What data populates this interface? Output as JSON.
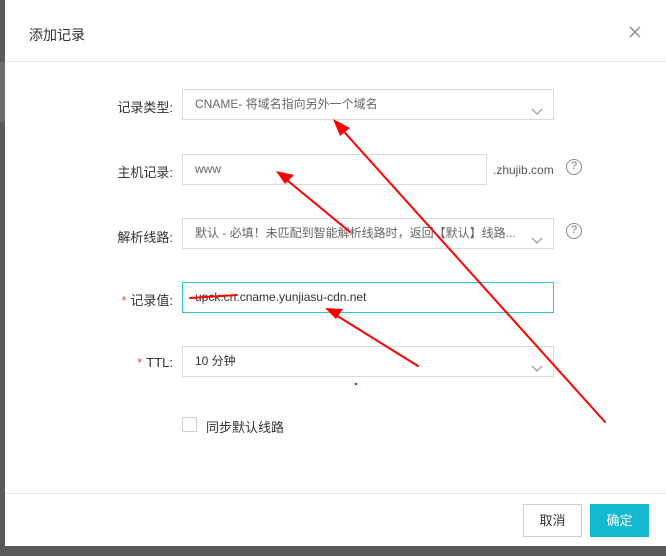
{
  "dialog": {
    "title": "添加记录",
    "close_icon": "close-icon"
  },
  "form": {
    "record_type": {
      "label": "记录类型:",
      "value": "CNAME- 将域名指向另外一个域名"
    },
    "host": {
      "label": "主机记录:",
      "value": "www",
      "suffix": ".zhujib.com"
    },
    "line": {
      "label": "解析线路:",
      "value": "默认 - 必填！未匹配到智能解析线路时，返回【默认】线路..."
    },
    "record_value": {
      "required_mark": "*",
      "label": "记录值:",
      "value": "upck.cn.cname.yunjiasu-cdn.net"
    },
    "ttl": {
      "required_mark": "*",
      "label": "TTL:",
      "value": "10 分钟"
    },
    "sync_default": {
      "label": "同步默认线路",
      "checked": false
    }
  },
  "help_text": "?",
  "buttons": {
    "cancel": "取消",
    "ok": "确定"
  },
  "colors": {
    "accent": "#15b9cf",
    "annotation": "#ff0000",
    "required": "#e0513b"
  }
}
